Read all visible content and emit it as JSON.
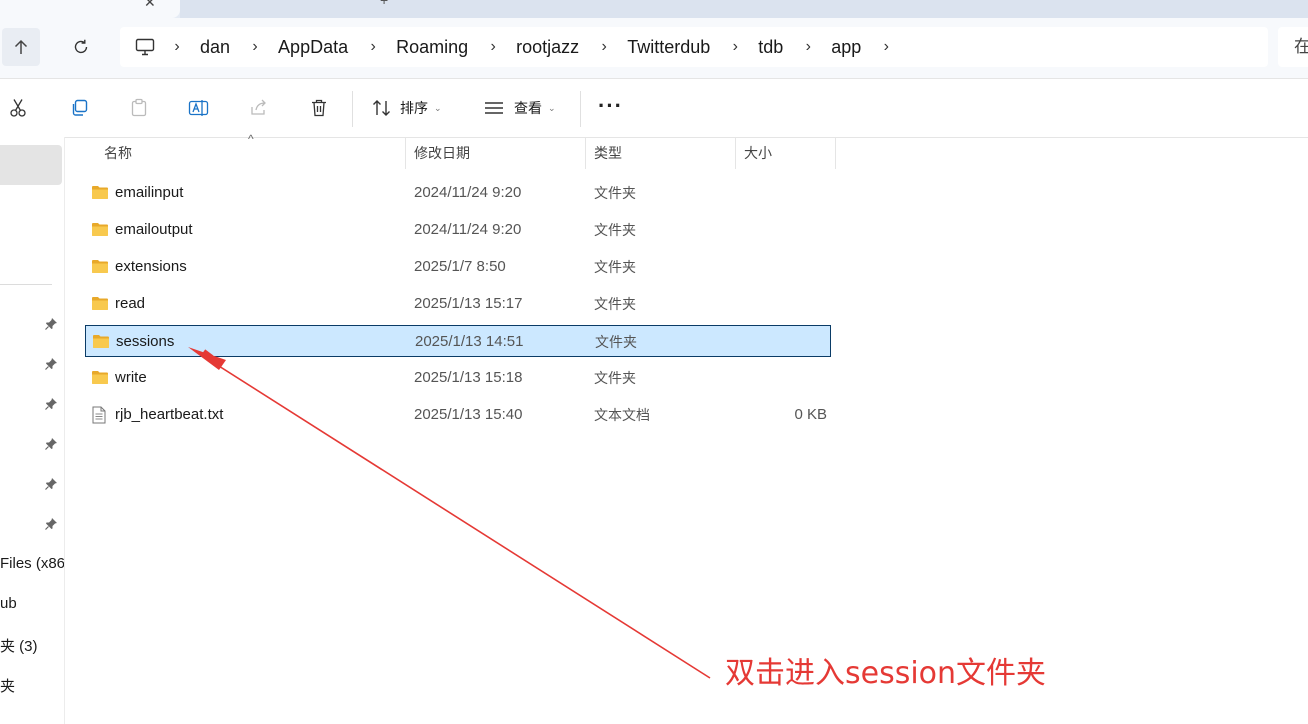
{
  "tabs": {
    "active_close_glyph": "✕",
    "new_tab_glyph": "+"
  },
  "nav": {
    "up_icon": "arrow-up-icon",
    "refresh_icon": "refresh-icon",
    "breadcrumbs": [
      "dan",
      "AppData",
      "Roaming",
      "rootjazz",
      "Twitterdub",
      "tdb",
      "app"
    ],
    "search_partial": "在"
  },
  "toolbar": {
    "cut_icon": "scissors-icon",
    "copy_icon": "copy-icon",
    "paste_icon": "paste-icon",
    "rename_icon": "rename-icon",
    "share_icon": "share-icon",
    "delete_icon": "trash-icon",
    "sort_label": "排序",
    "view_label": "查看",
    "more_label": "···"
  },
  "sidebar": {
    "partial_items": [
      "Files (x86",
      "ub",
      "夹 (3)",
      "夹"
    ]
  },
  "columns": {
    "name": "名称",
    "modified": "修改日期",
    "type": "类型",
    "size": "大小"
  },
  "files": [
    {
      "name": "emailinput",
      "modified": "2024/11/24 9:20",
      "type": "文件夹",
      "size": "",
      "icon": "folder-icon"
    },
    {
      "name": "emailoutput",
      "modified": "2024/11/24 9:20",
      "type": "文件夹",
      "size": "",
      "icon": "folder-icon"
    },
    {
      "name": "extensions",
      "modified": "2025/1/7 8:50",
      "type": "文件夹",
      "size": "",
      "icon": "folder-icon"
    },
    {
      "name": "read",
      "modified": "2025/1/13 15:17",
      "type": "文件夹",
      "size": "",
      "icon": "folder-icon"
    },
    {
      "name": "sessions",
      "modified": "2025/1/13 14:51",
      "type": "文件夹",
      "size": "",
      "icon": "folder-icon",
      "selected": true
    },
    {
      "name": "write",
      "modified": "2025/1/13 15:18",
      "type": "文件夹",
      "size": "",
      "icon": "folder-icon"
    },
    {
      "name": "rjb_heartbeat.txt",
      "modified": "2025/1/13 15:40",
      "type": "文本文档",
      "size": "0 KB",
      "icon": "text-file-icon"
    }
  ],
  "annotation": {
    "text": "双击进入session文件夹",
    "color": "#e53935"
  },
  "colors": {
    "selection": "#cce8ff",
    "folder": "#f4c34e",
    "accent": "#0067c0"
  }
}
